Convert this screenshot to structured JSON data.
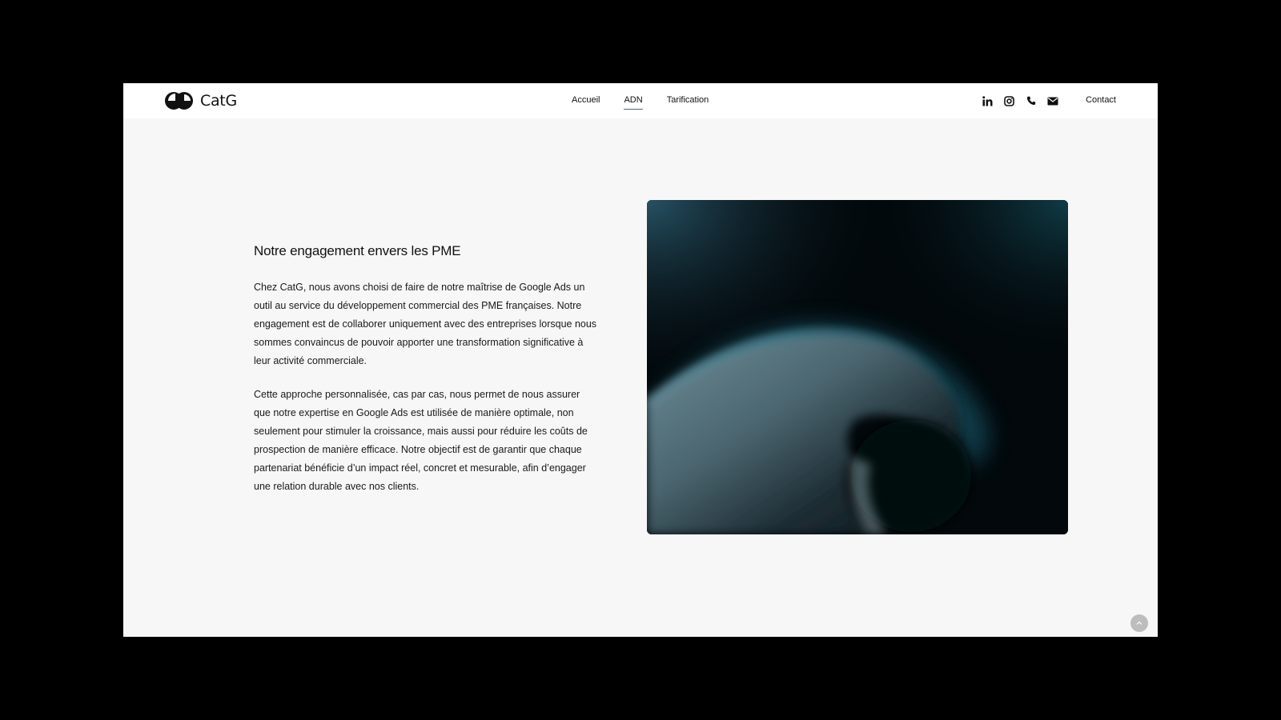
{
  "header": {
    "brand": "CatG",
    "nav": [
      {
        "label": "Accueil",
        "active": false
      },
      {
        "label": "ADN",
        "active": true
      },
      {
        "label": "Tarification",
        "active": false
      }
    ],
    "social_icons": [
      "linkedin-icon",
      "instagram-icon",
      "phone-icon",
      "email-icon"
    ],
    "contact_label": "Contact"
  },
  "main": {
    "heading": "Notre engagement envers les PME",
    "paragraphs": [
      "Chez CatG, nous avons choisi de faire de notre maîtrise de Google Ads un outil au service du développement commercial des PME françaises. Notre engagement est de collaborer uniquement avec des entreprises lorsque nous sommes convaincus de pouvoir apporter une transformation significative à leur activité commerciale.",
      "Cette approche personnalisée, cas par cas, nous permet de nous assurer que notre expertise en Google Ads est utilisée de manière optimale, non seulement pour stimuler la croissance, mais aussi pour réduire les coûts de prospection de manière efficace. Notre objectif est de garantir que chaque partenariat bénéficie d’un impact réel, concret et mesurable, afin d’engager une relation durable avec nos clients."
    ]
  },
  "colors": {
    "accent": "#3d6f82",
    "page_bg": "#f7f7f7",
    "outer_bg": "#000000"
  }
}
